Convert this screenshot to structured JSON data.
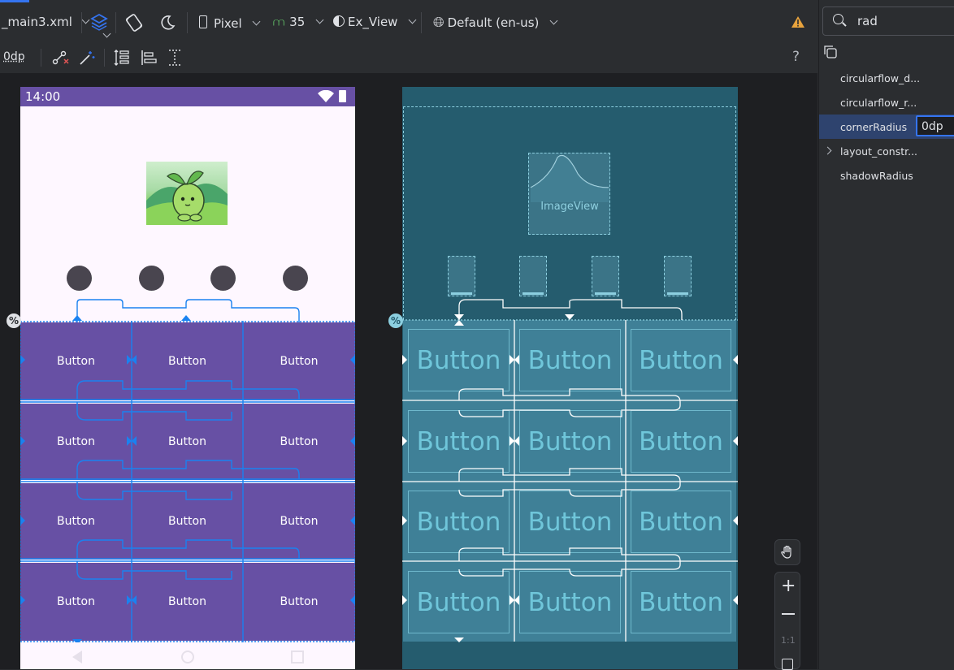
{
  "toolbar": {
    "file_tab": "_main3.xml",
    "device": "Pixel",
    "api_level": "35",
    "theme": "Ex_View",
    "locale": "Default (en-us)",
    "margin_value": "0dp",
    "help": "?"
  },
  "search": {
    "value": "rad"
  },
  "attributes": [
    {
      "name": "circularflow_d..."
    },
    {
      "name": "circularflow_r..."
    },
    {
      "name": "cornerRadius",
      "value": "0dp"
    },
    {
      "name": "layout_constr..."
    },
    {
      "name": "shadowRadius"
    }
  ],
  "phone": {
    "time": "14:00",
    "buttons": [
      "Button",
      "Button",
      "Button",
      "Button",
      "Button",
      "Button",
      "Button",
      "Button",
      "Button",
      "Button",
      "Button",
      "Button"
    ]
  },
  "blueprint": {
    "image_label": "ImageView",
    "buttons": [
      "Button",
      "Button",
      "Button",
      "Button",
      "Button",
      "Button",
      "Button",
      "Button",
      "Button",
      "Button",
      "Button",
      "Button"
    ]
  },
  "zoom": {
    "one_to_one": "1:1"
  },
  "badge": "%",
  "colors": {
    "accent": "#3574f0",
    "primary_purple": "#6750a4",
    "blueprint_bg": "#255c6e",
    "warning": "#e8a33d"
  }
}
